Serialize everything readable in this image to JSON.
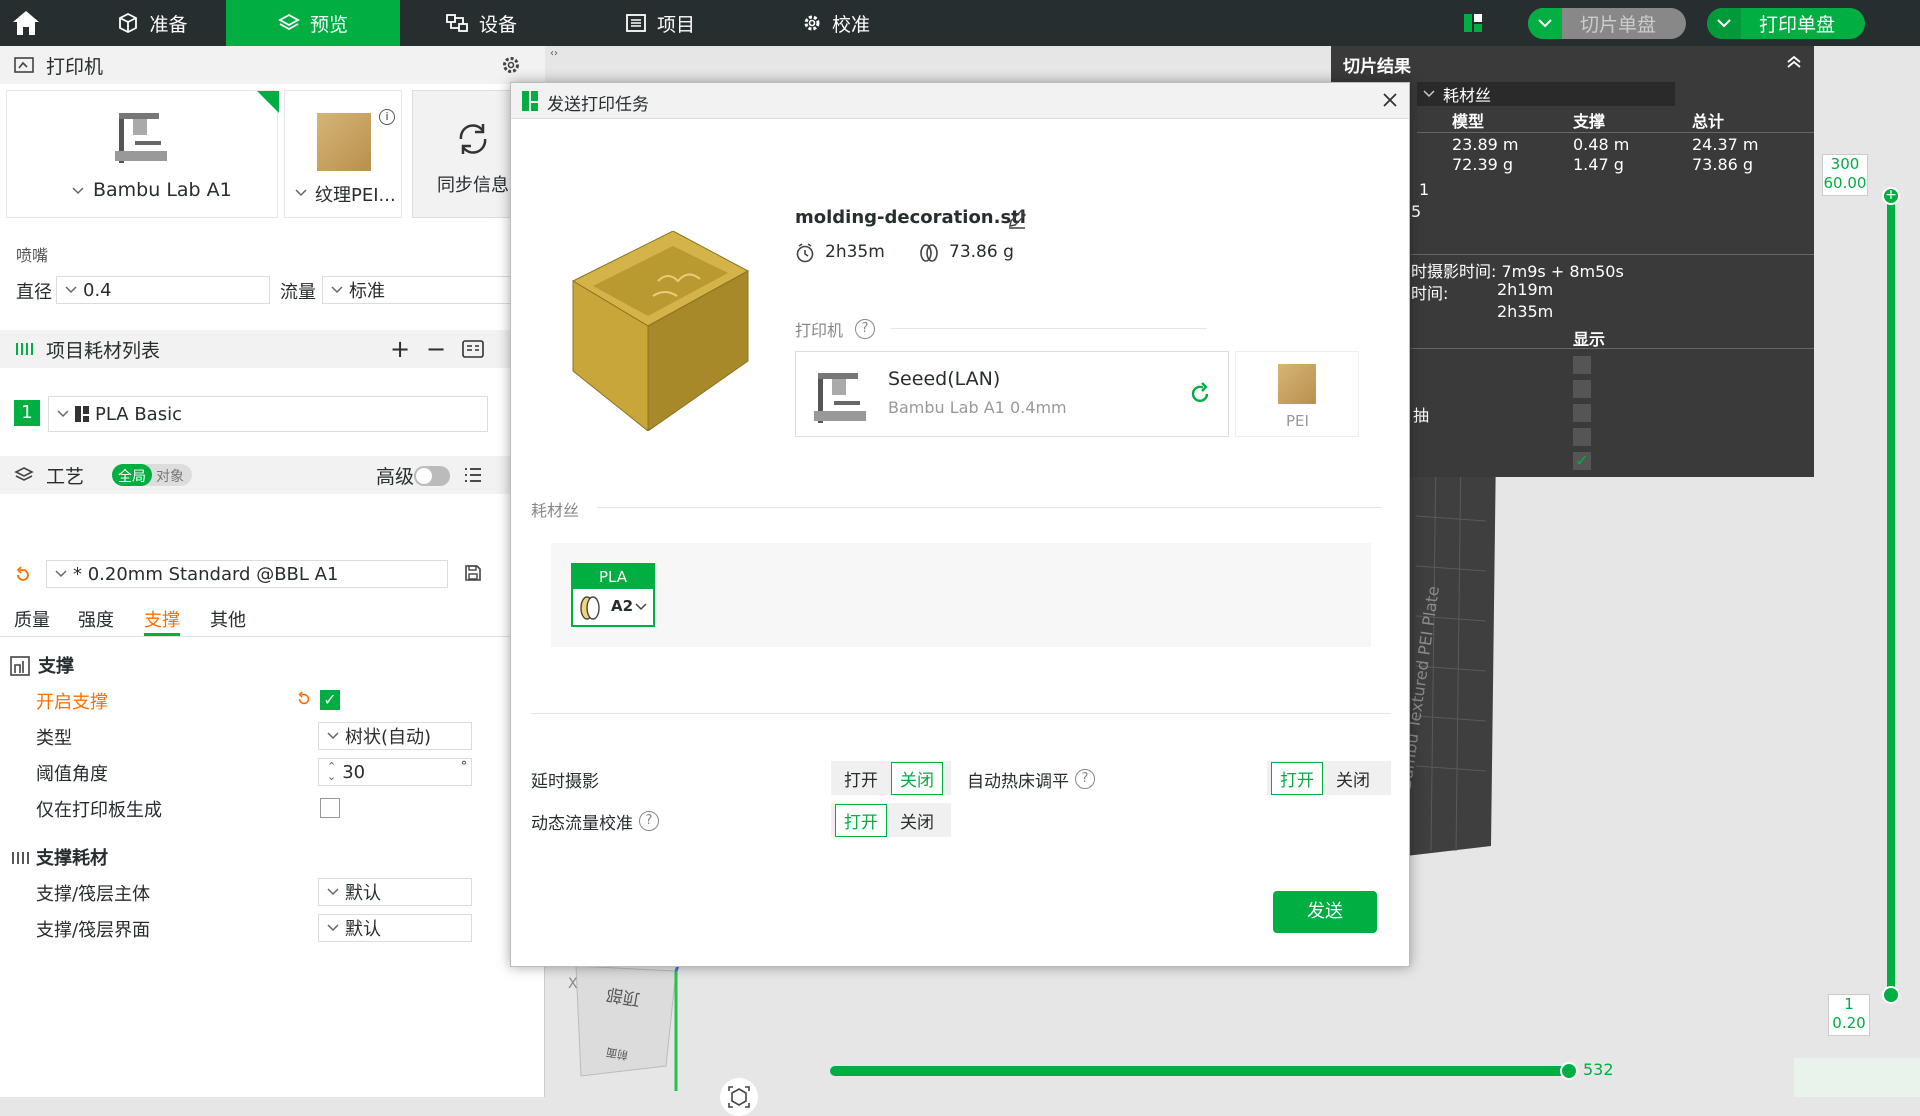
{
  "topbar": {
    "tabs": [
      {
        "label": "准备"
      },
      {
        "label": "预览"
      },
      {
        "label": "设备"
      },
      {
        "label": "项目"
      },
      {
        "label": "校准"
      }
    ],
    "slice_button": "切片单盘",
    "print_button": "打印单盘"
  },
  "left": {
    "printer_header": "打印机",
    "printer_name": "Bambu Lab A1",
    "plate_name": "纹理PEI...",
    "sync_label": "同步信息",
    "nozzle_label": "喷嘴",
    "diameter_label": "直径",
    "diameter_value": "0.4",
    "flow_label": "流量",
    "flow_value": "标准",
    "filament_header": "项目耗材列表",
    "filament_index": "1",
    "filament_name": "PLA Basic",
    "process_header": "工艺",
    "scope_global": "全局",
    "scope_object": "对象",
    "advanced_label": "高级",
    "preset": "* 0.20mm Standard @BBL A1",
    "tabs": [
      "质量",
      "强度",
      "支撑",
      "其他"
    ],
    "support_section": "支撑",
    "enable_support": "开启支撑",
    "type_label": "类型",
    "type_value": "树状(自动)",
    "threshold_label": "阈值角度",
    "threshold_value": "30",
    "threshold_unit": "°",
    "only_plate_label": "仅在打印板生成",
    "support_filament_section": "支撑耗材",
    "base_label": "支撑/筏层主体",
    "base_value": "默认",
    "interface_label": "支撑/筏层界面",
    "interface_value": "默认"
  },
  "slice_result": {
    "title": "切片结果",
    "filament_toggle": "耗材丝",
    "headers": [
      "模型",
      "支撑",
      "总计"
    ],
    "rows": [
      [
        "23.89 m",
        "0.48 m",
        "24.37 m"
      ],
      [
        "72.39 g",
        "1.47 g",
        "73.86 g"
      ]
    ],
    "extra1": "1",
    "extra2": "5",
    "timelapse_time": "时摄影时间: 7m9s + 8m50s",
    "time_label": "时间:",
    "time1": "2h19m",
    "time2": "2h35m",
    "display_label": "显示",
    "axis_label": "抽"
  },
  "viewport": {
    "layer_top": "300",
    "height_top": "60.00",
    "layer_bottom": "1",
    "height_bottom": "0.20",
    "horizontal_value": "532",
    "plate_text": "Bambu Textured PEI Plate",
    "cube_face": "顶部",
    "cube_side": "前面",
    "axis_x": "X",
    "vertical_fraction": 1.0,
    "horizontal_fraction": 1.0
  },
  "dialog": {
    "title": "发送打印任务",
    "filename": "molding-decoration.stl",
    "time": "2h35m",
    "weight": "73.86 g",
    "printer_section": "打印机",
    "printer_name": "Seeed(LAN)",
    "printer_model": "Bambu Lab A1",
    "nozzle": "0.4mm",
    "plate_label": "PEI",
    "filament_section": "耗材丝",
    "filament_type": "PLA",
    "filament_slot": "A2",
    "timelapse_label": "延时摄影",
    "bed_level_label": "自动热床调平",
    "flow_cali_label": "动态流量校准",
    "on": "打开",
    "off": "关闭",
    "send_button": "发送"
  },
  "colors": {
    "accent": "#00ae42",
    "topbar": "#262e30",
    "warning": "#ff6f00",
    "object": "#c8a63a"
  }
}
